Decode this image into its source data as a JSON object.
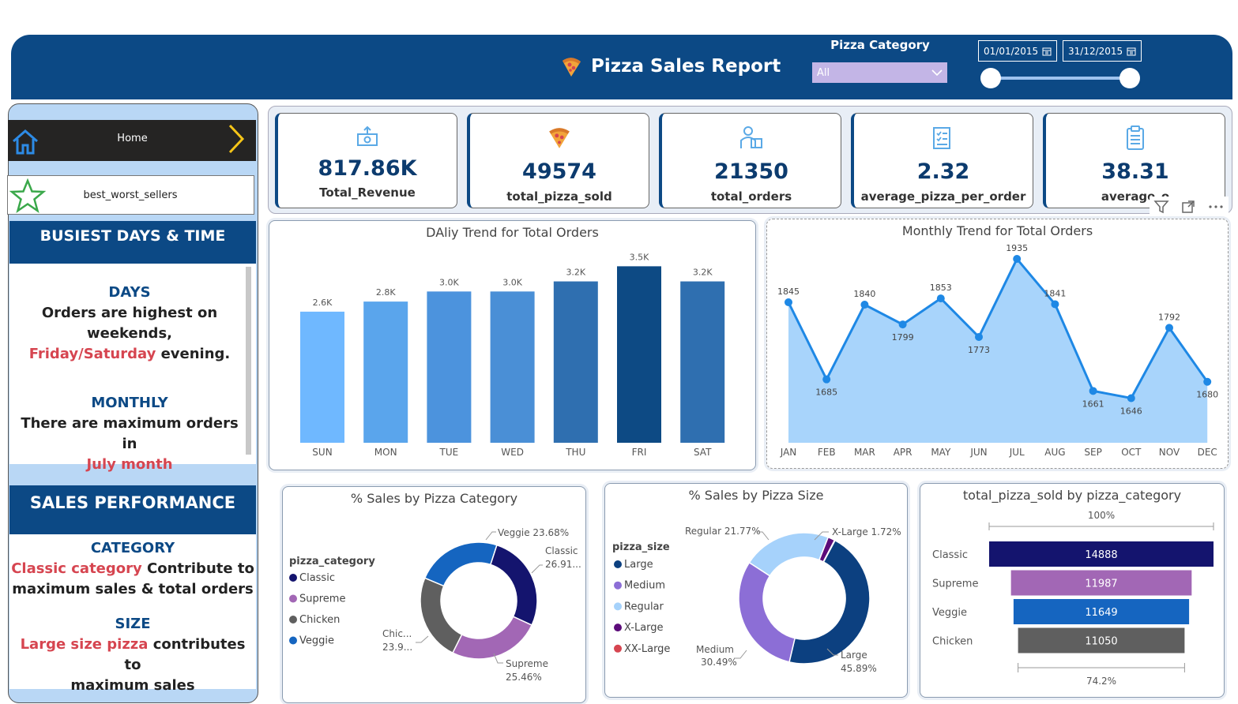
{
  "header": {
    "title": "Pizza Sales Report",
    "category_label": "Pizza Category",
    "category_value": "All",
    "date_start": "01/01/2015",
    "date_end": "31/12/2015"
  },
  "nav": {
    "home_label": "Home",
    "best_worst_label": "best_worst_sellers"
  },
  "busiest": {
    "heading": "BUSIEST DAYS & TIME",
    "days_title": "DAYS",
    "days_line1": "Orders are highest on",
    "days_line2": "weekends,",
    "days_highlight": "Friday/Saturday",
    "days_rest": " evening.",
    "monthly_title": "MONTHLY",
    "monthly_line1": "There are maximum orders in",
    "monthly_highlight": "July month"
  },
  "sales_perf": {
    "heading": "SALES PERFORMANCE",
    "category_title": "CATEGORY",
    "category_highlight": "Classic category",
    "category_rest": " Contribute to",
    "category_line2": "maximum sales & total orders",
    "size_title": "SIZE",
    "size_highlight": "Large size pizza",
    "size_rest": " contributes to",
    "size_line2": "maximum sales"
  },
  "kpis": [
    {
      "value": "817.86K",
      "label": "Total_Revenue",
      "icon": "money-icon"
    },
    {
      "value": "49574",
      "label": "total_pizza_sold",
      "icon": "pizza-slice-icon"
    },
    {
      "value": "21350",
      "label": "total_orders",
      "icon": "delivery-icon"
    },
    {
      "value": "2.32",
      "label": "average_pizza_per_order",
      "icon": "checklist-icon"
    },
    {
      "value": "38.31",
      "label": "average_o",
      "icon": "clipboard-icon"
    }
  ],
  "colors": {
    "header": "#0c4985",
    "accent_red": "#d64550",
    "daily_bars": [
      "#6fb8ff",
      "#5aa5ec",
      "#4c93dd",
      "#4a8fd6",
      "#2f6fb0",
      "#0d4a84",
      "#2f6fb0"
    ],
    "line": "#1e88e5",
    "area": "#a8d4fb",
    "classic": "#14146e",
    "supreme": "#a267b5",
    "chicken": "#5f5f5f",
    "veggie": "#1565c0",
    "large": "#0c4080",
    "medium": "#8c6ed6",
    "regular": "#a6d2fb",
    "xlarge": "#5c0c7a",
    "xxlarge": "#d64550"
  },
  "chart_data": [
    {
      "type": "bar",
      "title": "DAliy Trend for Total Orders",
      "categories": [
        "SUN",
        "MON",
        "TUE",
        "WED",
        "THU",
        "FRI",
        "SAT"
      ],
      "values": [
        2600,
        2800,
        3000,
        3000,
        3200,
        3500,
        3200
      ],
      "data_labels": [
        "2.6K",
        "2.8K",
        "3.0K",
        "3.0K",
        "3.2K",
        "3.5K",
        "3.2K"
      ]
    },
    {
      "type": "area",
      "title": "Monthly Trend for Total Orders",
      "categories": [
        "JAN",
        "FEB",
        "MAR",
        "APR",
        "MAY",
        "JUN",
        "JUL",
        "AUG",
        "SEP",
        "OCT",
        "NOV",
        "DEC"
      ],
      "values": [
        1845,
        1685,
        1840,
        1799,
        1853,
        1773,
        1935,
        1841,
        1661,
        1646,
        1792,
        1680
      ]
    },
    {
      "type": "pie",
      "title": "% Sales by Pizza Category",
      "legend_title": "pizza_category",
      "categories": [
        "Classic",
        "Supreme",
        "Chicken",
        "Veggie"
      ],
      "values": [
        26.91,
        25.46,
        23.96,
        23.68
      ],
      "data_labels": [
        "Classic 26.91...",
        "Supreme 25.46%",
        "Chic... 23.9...",
        "Veggie 23.68%"
      ]
    },
    {
      "type": "pie",
      "title": "% Sales by Pizza Size",
      "legend_title": "pizza_size",
      "categories": [
        "Large",
        "Medium",
        "Regular",
        "X-Large",
        "XX-Large"
      ],
      "values": [
        45.89,
        30.49,
        21.77,
        1.72,
        0.12
      ],
      "data_labels": [
        "Large 45.89%",
        "Medium 30.49%",
        "Regular 21.77%",
        "X-Large 1.72%",
        ""
      ]
    },
    {
      "type": "bar",
      "title": "total_pizza_sold by pizza_category",
      "categories": [
        "Classic",
        "Supreme",
        "Veggie",
        "Chicken"
      ],
      "values": [
        14888,
        11987,
        11649,
        11050
      ],
      "top_label": "100%",
      "bottom_label": "74.2%"
    }
  ]
}
